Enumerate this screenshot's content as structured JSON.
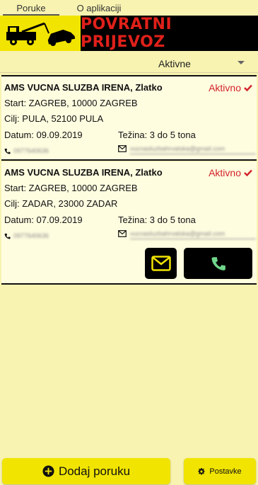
{
  "tabs": [
    {
      "label": "Poruke",
      "active": true
    },
    {
      "label": "O aplikaciji",
      "active": false
    }
  ],
  "banner": {
    "title": "POVRATNI PRIJEVOZ",
    "logo_icon": "tow-truck-icon"
  },
  "filter": {
    "selected": "Aktivne"
  },
  "messages": [
    {
      "company": "AMS VUCNA SLUZBA IRENA, Zlatko",
      "status": "Aktivno",
      "start": "Start: ZAGREB, 10000 ZAGREB",
      "destination": "Cilj: PULA, 52100 PULA",
      "date": "Datum: 09.09.2019",
      "weight": "Težina: 3 do 5 tona",
      "phone": "0977640636",
      "email": "vucnasluzbahrvatska@gmail.com"
    },
    {
      "company": "AMS VUCNA SLUZBA IRENA, Zlatko",
      "status": "Aktivno",
      "start": "Start: ZAGREB, 10000 ZAGREB",
      "destination": "Cilj: ZADAR, 23000 ZADAR",
      "date": "Datum: 07.09.2019",
      "weight": "Težina: 3 do 5 tona",
      "phone": "0977640636",
      "email": "vucnasluzbahrvatska@gmail.com"
    }
  ],
  "actions": {
    "add_label": "Dodaj poruku",
    "settings_label": "Postavke"
  },
  "colors": {
    "background": "#f8f3b1",
    "accent_yellow": "#f1e400",
    "status_red": "#d2232a",
    "call_green": "#6fd68a"
  }
}
